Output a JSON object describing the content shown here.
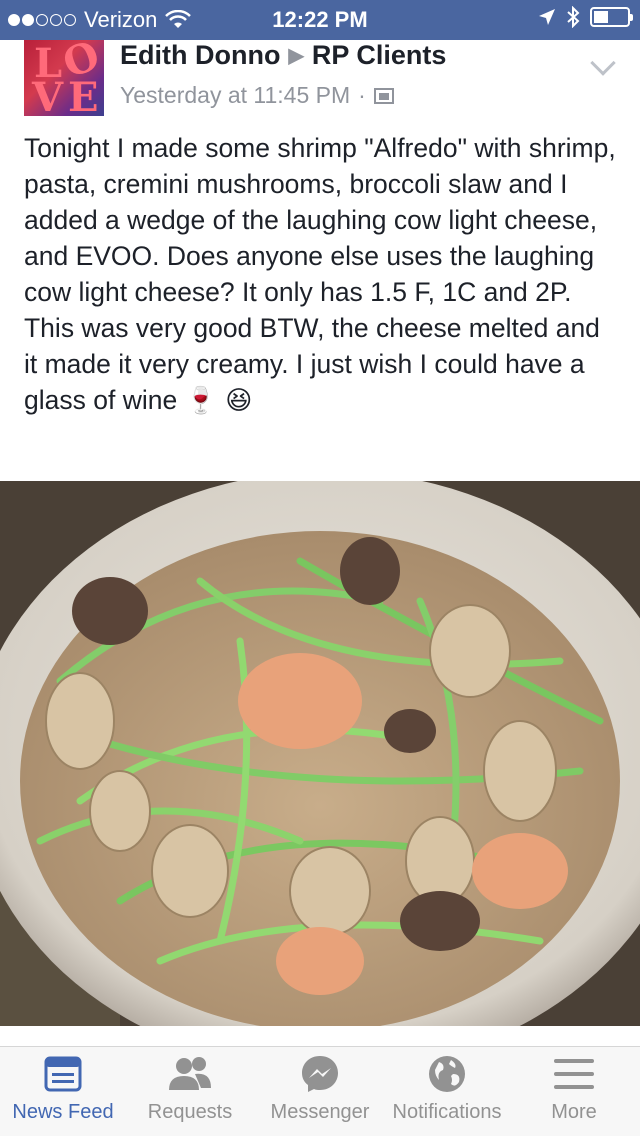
{
  "status_bar": {
    "carrier": "Verizon",
    "time": "12:22 PM",
    "signal_bars_filled": 2,
    "signal_bars_total": 5
  },
  "post": {
    "author": "Edith Donno",
    "group": "RP Clients",
    "timestamp": "Yesterday at 11:45 PM",
    "separator": "·",
    "text": "Tonight I made some shrimp \"Alfredo\" with shrimp,  pasta, cremini mushrooms, broccoli slaw and I added a wedge of the laughing cow light cheese, and EVOO. Does anyone else uses the laughing cow light cheese? It only has 1.5 F, 1C and 2P. This was very good BTW, the cheese melted and it made it very creamy. I just wish I could have a glass of wine",
    "emoji": "🍷 😆",
    "photo_description_icon": "food-photo"
  },
  "tabs": [
    {
      "label": "News Feed",
      "icon": "news-feed-icon",
      "active": true
    },
    {
      "label": "Requests",
      "icon": "friend-requests-icon",
      "active": false
    },
    {
      "label": "Messenger",
      "icon": "messenger-icon",
      "active": false
    },
    {
      "label": "Notifications",
      "icon": "globe-icon",
      "active": false
    },
    {
      "label": "More",
      "icon": "menu-icon",
      "active": false
    }
  ],
  "colors": {
    "status_bar": "#4a66a0",
    "accent": "#4267b2",
    "inactive": "#929292"
  }
}
